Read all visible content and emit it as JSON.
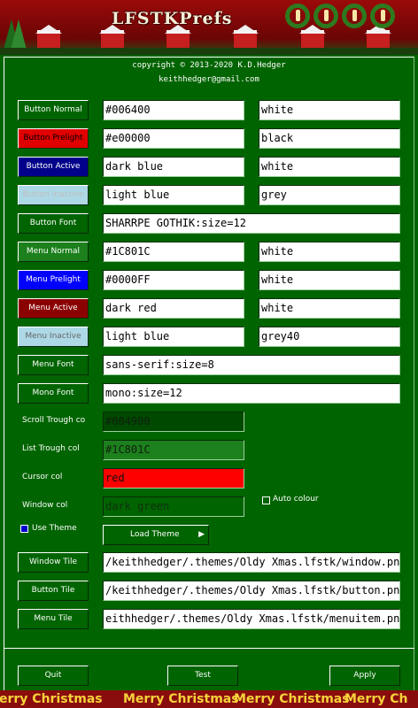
{
  "app": {
    "title": "LFSTKPrefs",
    "copyright": "copyright © 2013-2020 K.D.Hedger",
    "email": "keithhedger@gmail.com"
  },
  "rows": [
    {
      "button": "Button Normal",
      "color": "#006400",
      "fg": "white",
      "button_bg": "#006400",
      "button_fg": "#ffffff"
    },
    {
      "button": "Button Prelight",
      "color": "#e00000",
      "fg": "black",
      "button_bg": "#e00000",
      "button_fg": "#000000"
    },
    {
      "button": "Button Active",
      "color": "dark blue",
      "fg": "white",
      "button_bg": "#00008b",
      "button_fg": "#ffffff"
    },
    {
      "button": "Button Inactive",
      "color": "light blue",
      "fg": "grey",
      "button_bg": "#add8e6",
      "button_fg": "#bebebe"
    },
    {
      "button": "Button Font",
      "font": "SHARRPE GOTHIK:size=12"
    },
    {
      "button": "Menu Normal",
      "color": "#1C801C",
      "fg": "white",
      "button_bg": "#1c801c",
      "button_fg": "#ffffff"
    },
    {
      "button": "Menu Prelight",
      "color": "#0000FF",
      "fg": "white",
      "button_bg": "#0000ff",
      "button_fg": "#ffffff"
    },
    {
      "button": "Menu Active",
      "color": "dark red",
      "fg": "white",
      "button_bg": "#8b0000",
      "button_fg": "#ffffff"
    },
    {
      "button": "Menu Inactive",
      "color": "light blue",
      "fg": "grey40",
      "button_bg": "#add8e6",
      "button_fg": "#666666"
    },
    {
      "button": "Menu Font",
      "font": "sans-serif:size=8"
    },
    {
      "button": "Mono Font",
      "font": "mono:size=12"
    }
  ],
  "swatches": [
    {
      "label": "Scroll Trough co",
      "value": "#004900",
      "bg": "#004900",
      "fg": "#0f1f0f"
    },
    {
      "label": "List Trough col",
      "value": "#1C801C",
      "bg": "#1c801c",
      "fg": "#0f1f0f"
    },
    {
      "label": "Cursor col",
      "value": "red",
      "bg": "#ff0000",
      "fg": "#101010"
    },
    {
      "label": "Window col",
      "value": "dark green",
      "bg": "#006400",
      "fg": "#103010"
    }
  ],
  "auto_colour": {
    "label": "Auto colour",
    "checked": false
  },
  "use_theme": {
    "label": "Use Theme",
    "checked": true
  },
  "load_theme": {
    "label": "Load Theme",
    "arrow": "▶"
  },
  "tiles": [
    {
      "button": "Window Tile",
      "path": "/keithhedger/.themes/Oldy Xmas.lfstk/window.png"
    },
    {
      "button": "Button Tile",
      "path": "/keithhedger/.themes/Oldy Xmas.lfstk/button.png"
    },
    {
      "button": "Menu Tile",
      "path": "eithhedger/.themes/Oldy Xmas.lfstk/menuitem.png"
    }
  ],
  "actions": {
    "quit": "Quit",
    "test": "Test",
    "apply": "Apply"
  },
  "footer": [
    "erry Christmas",
    "Merry Christmas",
    "Merry Christmas",
    "Merry Ch"
  ],
  "colors": {
    "background": "#006400",
    "banner": "#8a0d0d",
    "footer_text": "#f6d23a"
  }
}
